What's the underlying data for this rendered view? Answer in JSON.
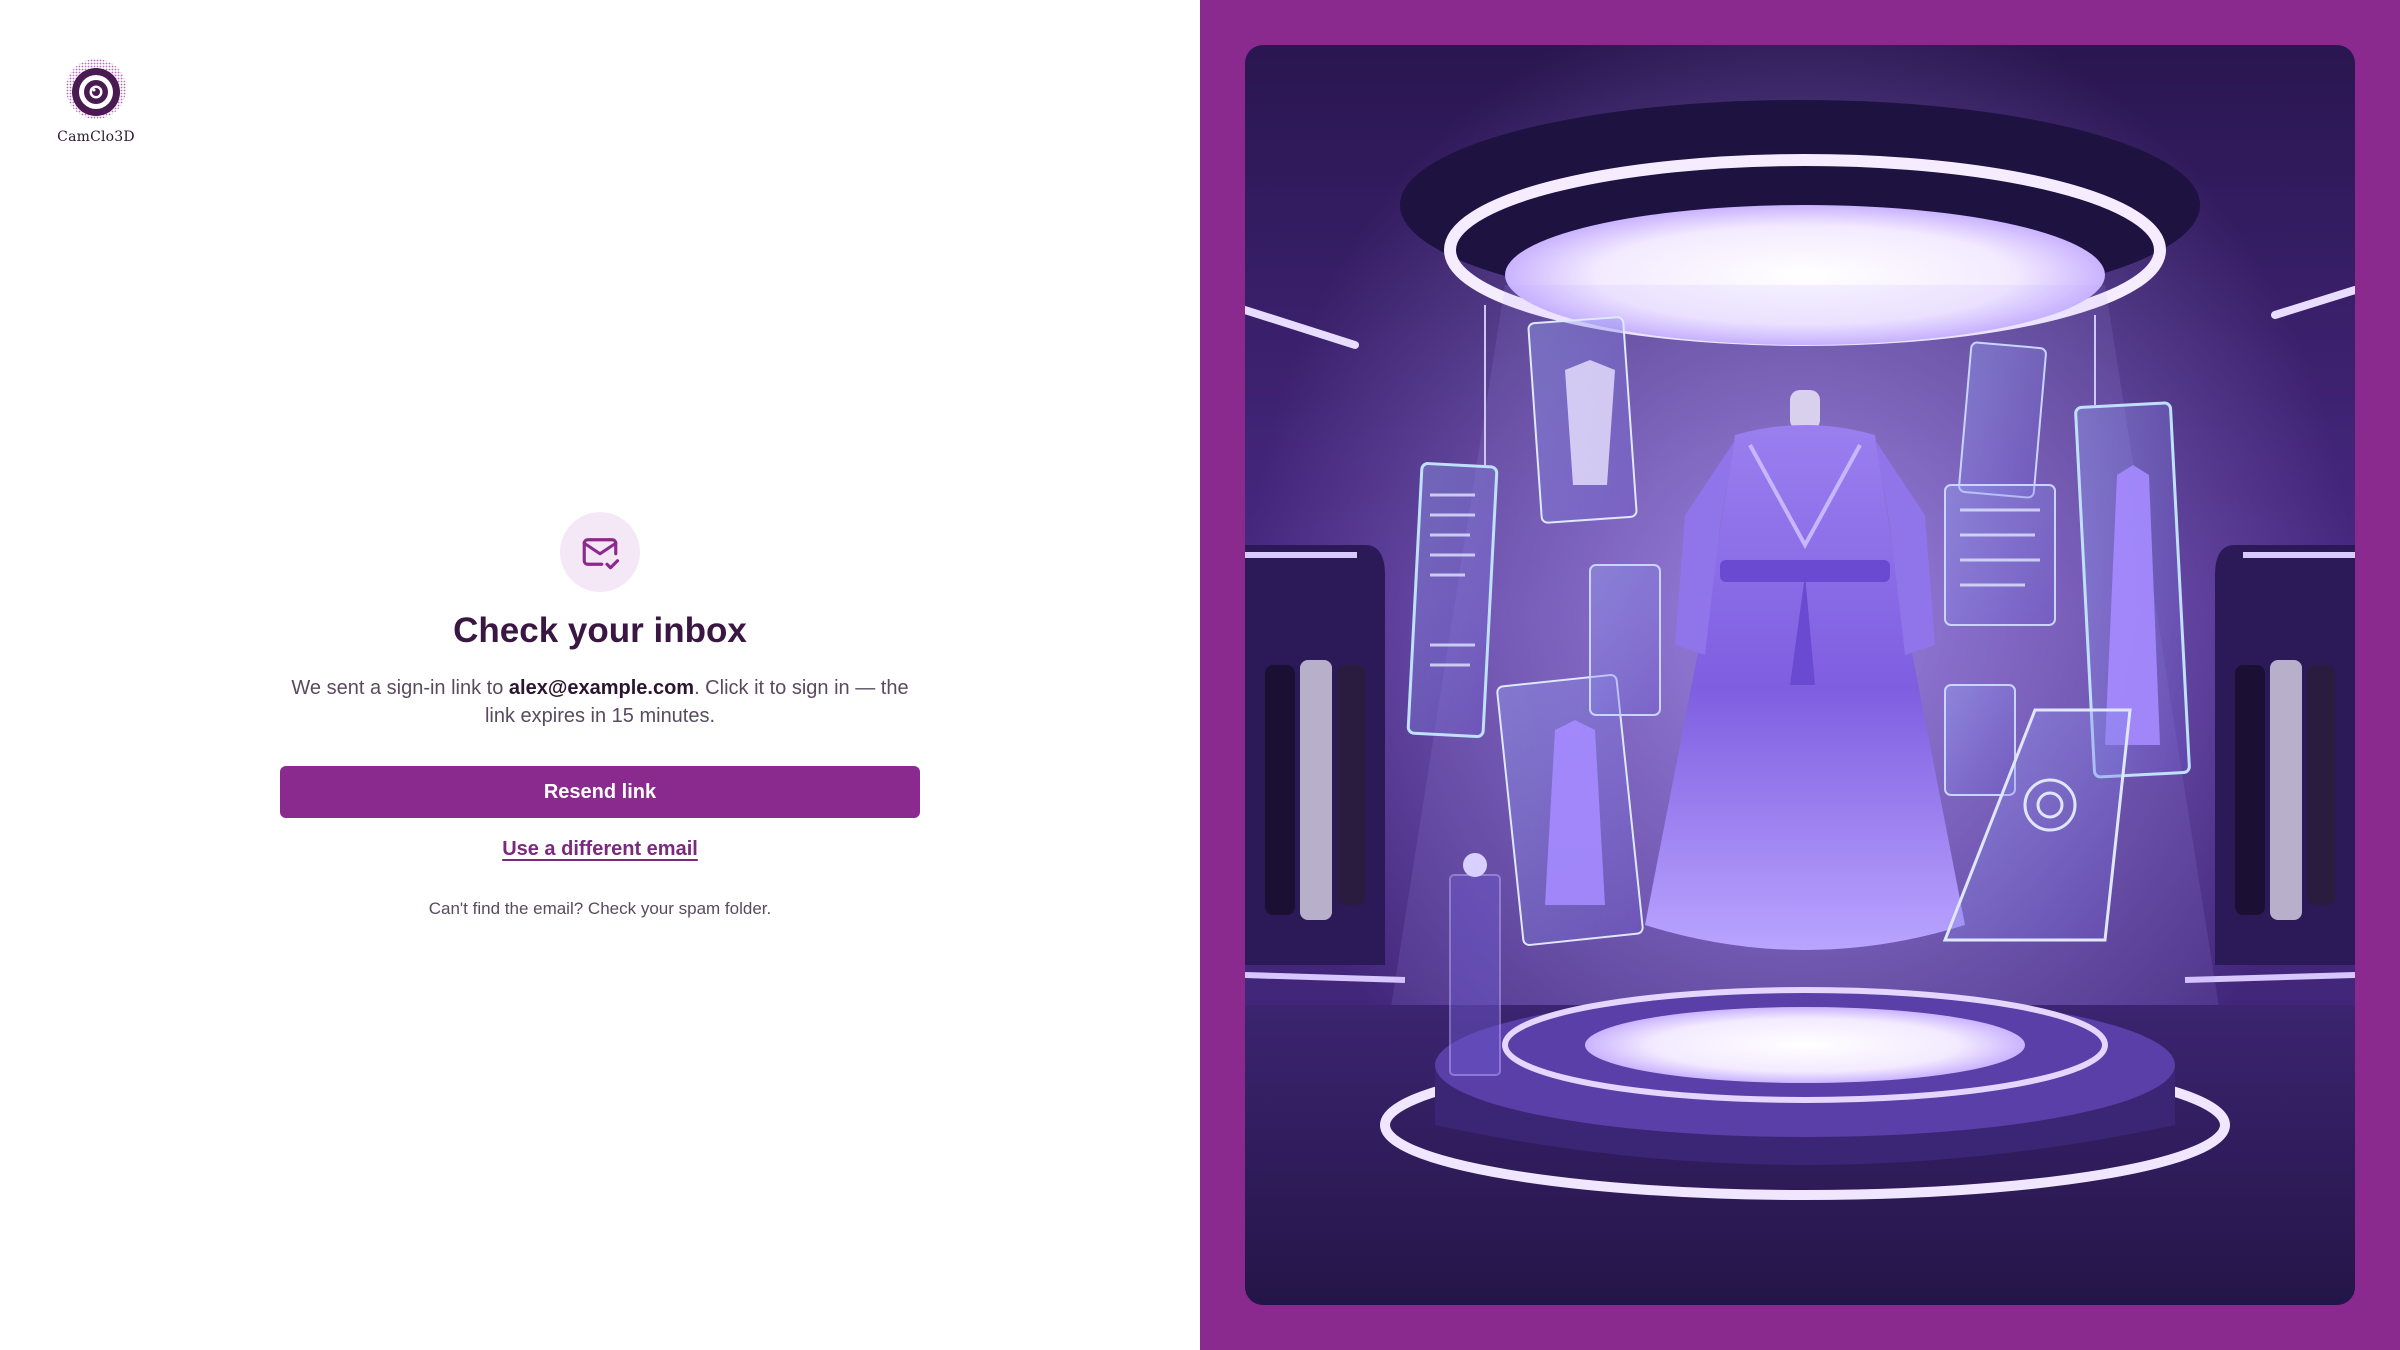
{
  "brand": {
    "name": "CamClo3D"
  },
  "main": {
    "title": "Check your inbox",
    "desc_prefix": "We sent a sign-in link to ",
    "email": "alex@example.com",
    "desc_suffix": ". Click it to sign in — the link expires in 15 minutes.",
    "resend_label": "Resend link",
    "alt_email_label": "Use a different email",
    "hint": "Can't find the email? Check your spam folder."
  },
  "icons": {
    "main_icon": "mail-check-icon",
    "logo_icon": "camera-lens-logo"
  },
  "colors": {
    "brand": "#8b2a8e",
    "title": "#3a1742",
    "icon_bg": "#f5e8f6"
  }
}
